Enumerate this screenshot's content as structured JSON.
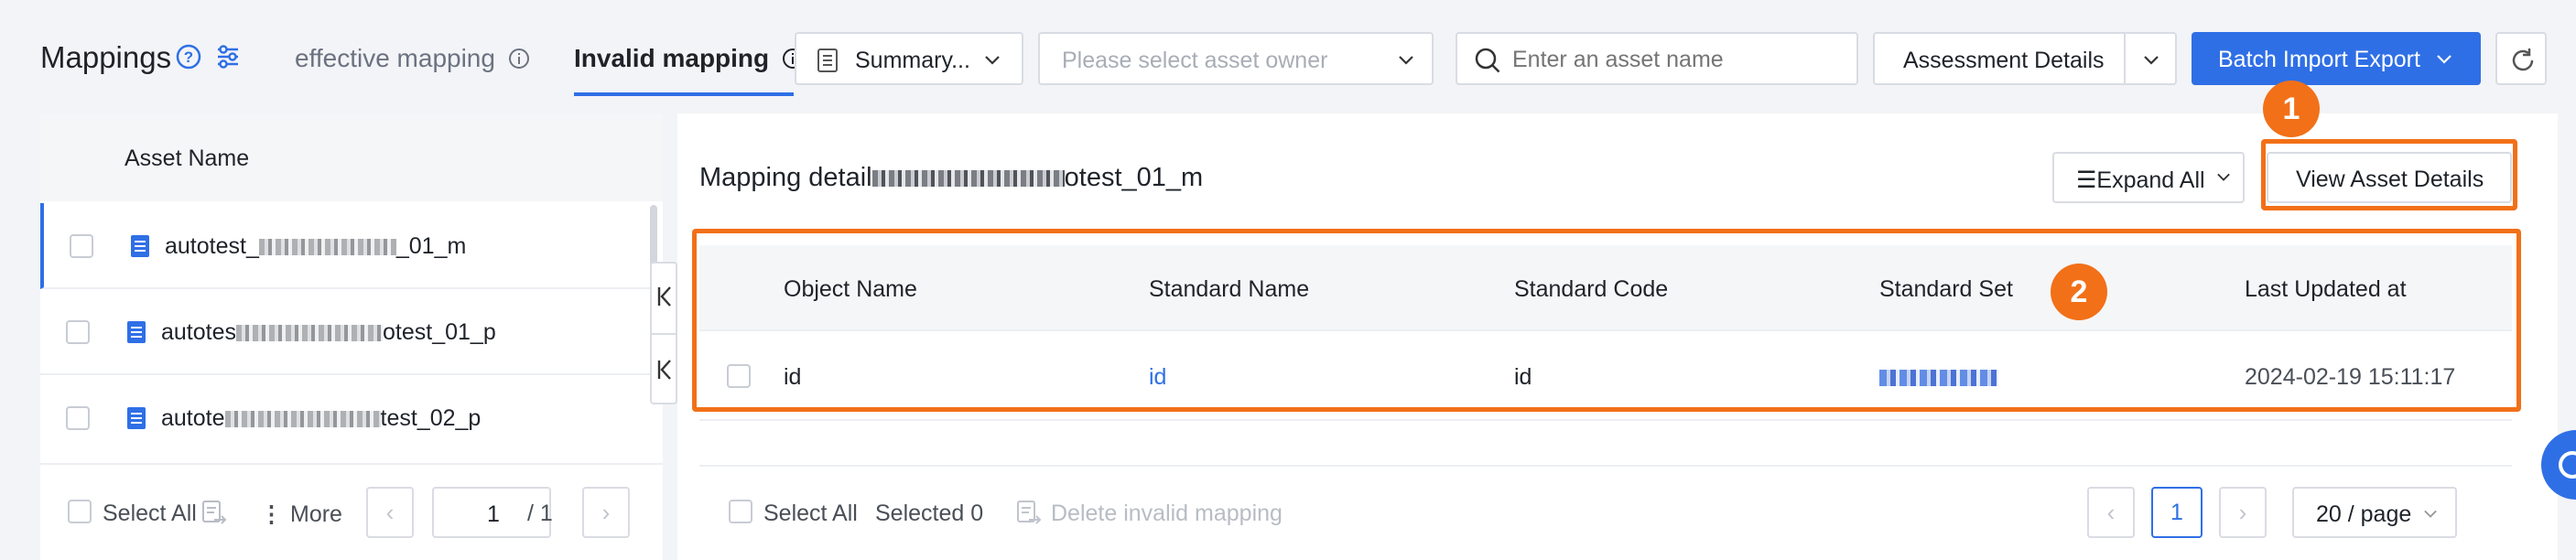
{
  "header": {
    "title": "Mappings",
    "tabs": [
      {
        "label": "effective mapping"
      },
      {
        "label": "Invalid mapping"
      }
    ],
    "summary_select": "Summary...",
    "owner_placeholder": "Please select asset owner",
    "search_placeholder": "Enter an asset name",
    "assessment_button": "Assessment Details",
    "batch_button": "Batch Import Export"
  },
  "left_panel": {
    "column_header": "Asset Name",
    "items": [
      {
        "prefix": "autotest_",
        "suffix": "_01_m"
      },
      {
        "prefix": "autotes",
        "suffix": "otest_01_p"
      },
      {
        "prefix": "autote",
        "suffix": "test_02_p"
      }
    ],
    "select_all": "Select All",
    "more": "More",
    "page_value": "1",
    "page_total": "/ 1"
  },
  "right_panel": {
    "detail_prefix": "Mapping detail",
    "detail_suffix": "otest_01_m",
    "expand_all": "Expand All",
    "view_asset_details": "View Asset Details",
    "columns": [
      "Object Name",
      "Standard Name",
      "Standard Code",
      "Standard Set",
      "Last Updated at"
    ],
    "rows": [
      {
        "object_name": "id",
        "standard_name": "id",
        "standard_code": "id",
        "last_updated": "2024-02-19 15:11:17"
      }
    ],
    "select_all": "Select All",
    "selected": "Selected 0",
    "delete_invalid": "Delete invalid mapping",
    "current_page": "1",
    "page_size": "20 / page"
  },
  "annotations": {
    "badge1": "1",
    "badge2": "2"
  },
  "colors": {
    "primary": "#2f6fe6",
    "annotation": "#f27018"
  }
}
